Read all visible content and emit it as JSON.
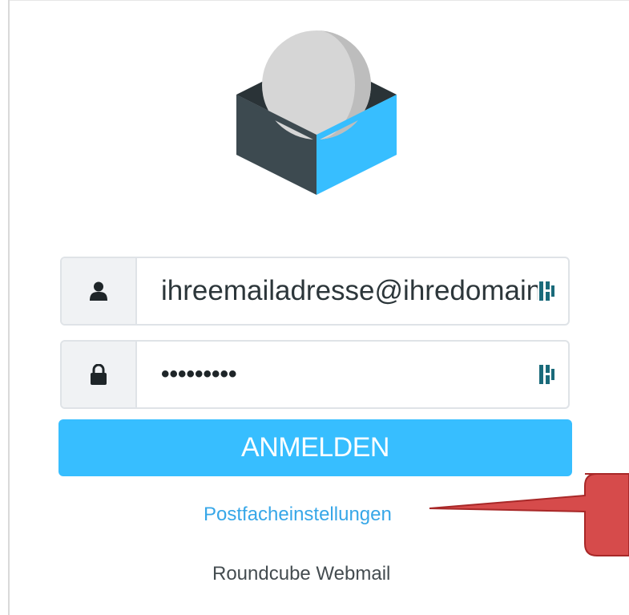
{
  "login": {
    "username_value": "ihreemailadresse@ihredomain.de",
    "password_value": "•••••••••",
    "submit_label": "ANMELDEN"
  },
  "links": {
    "settings_label": "Postfacheinstellungen"
  },
  "footer": {
    "product_name": "Roundcube Webmail"
  },
  "icons": {
    "logo": "roundcube-logo",
    "user": "user-icon",
    "lock": "lock-icon",
    "password_manager": "password-manager-icon"
  },
  "colors": {
    "accent": "#37beff",
    "link": "#37a7e8",
    "callout": "#d64b4b"
  }
}
